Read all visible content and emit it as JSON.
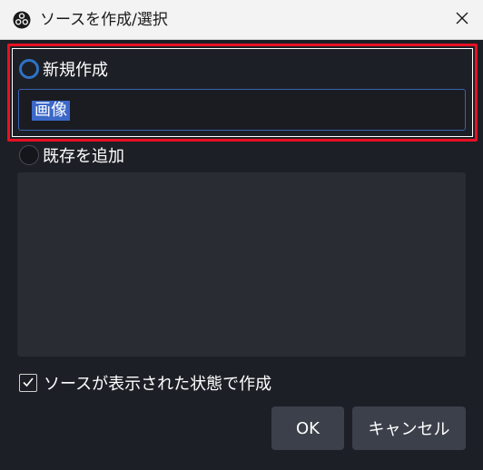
{
  "window": {
    "title": "ソースを作成/選択",
    "app_icon": "obs-icon",
    "close_icon": "close-icon"
  },
  "new_source": {
    "radio_label": "新規作成",
    "selected": true,
    "name_value": "画像"
  },
  "existing_source": {
    "radio_label": "既存を追加",
    "selected": false,
    "items": []
  },
  "visibility": {
    "label": "ソースが表示された状態で作成",
    "checked": true
  },
  "buttons": {
    "ok_label": "OK",
    "cancel_label": "キャンセル"
  },
  "colors": {
    "highlight_border": "#e81123",
    "accent": "#2f72c4",
    "background": "#1d1f26"
  }
}
